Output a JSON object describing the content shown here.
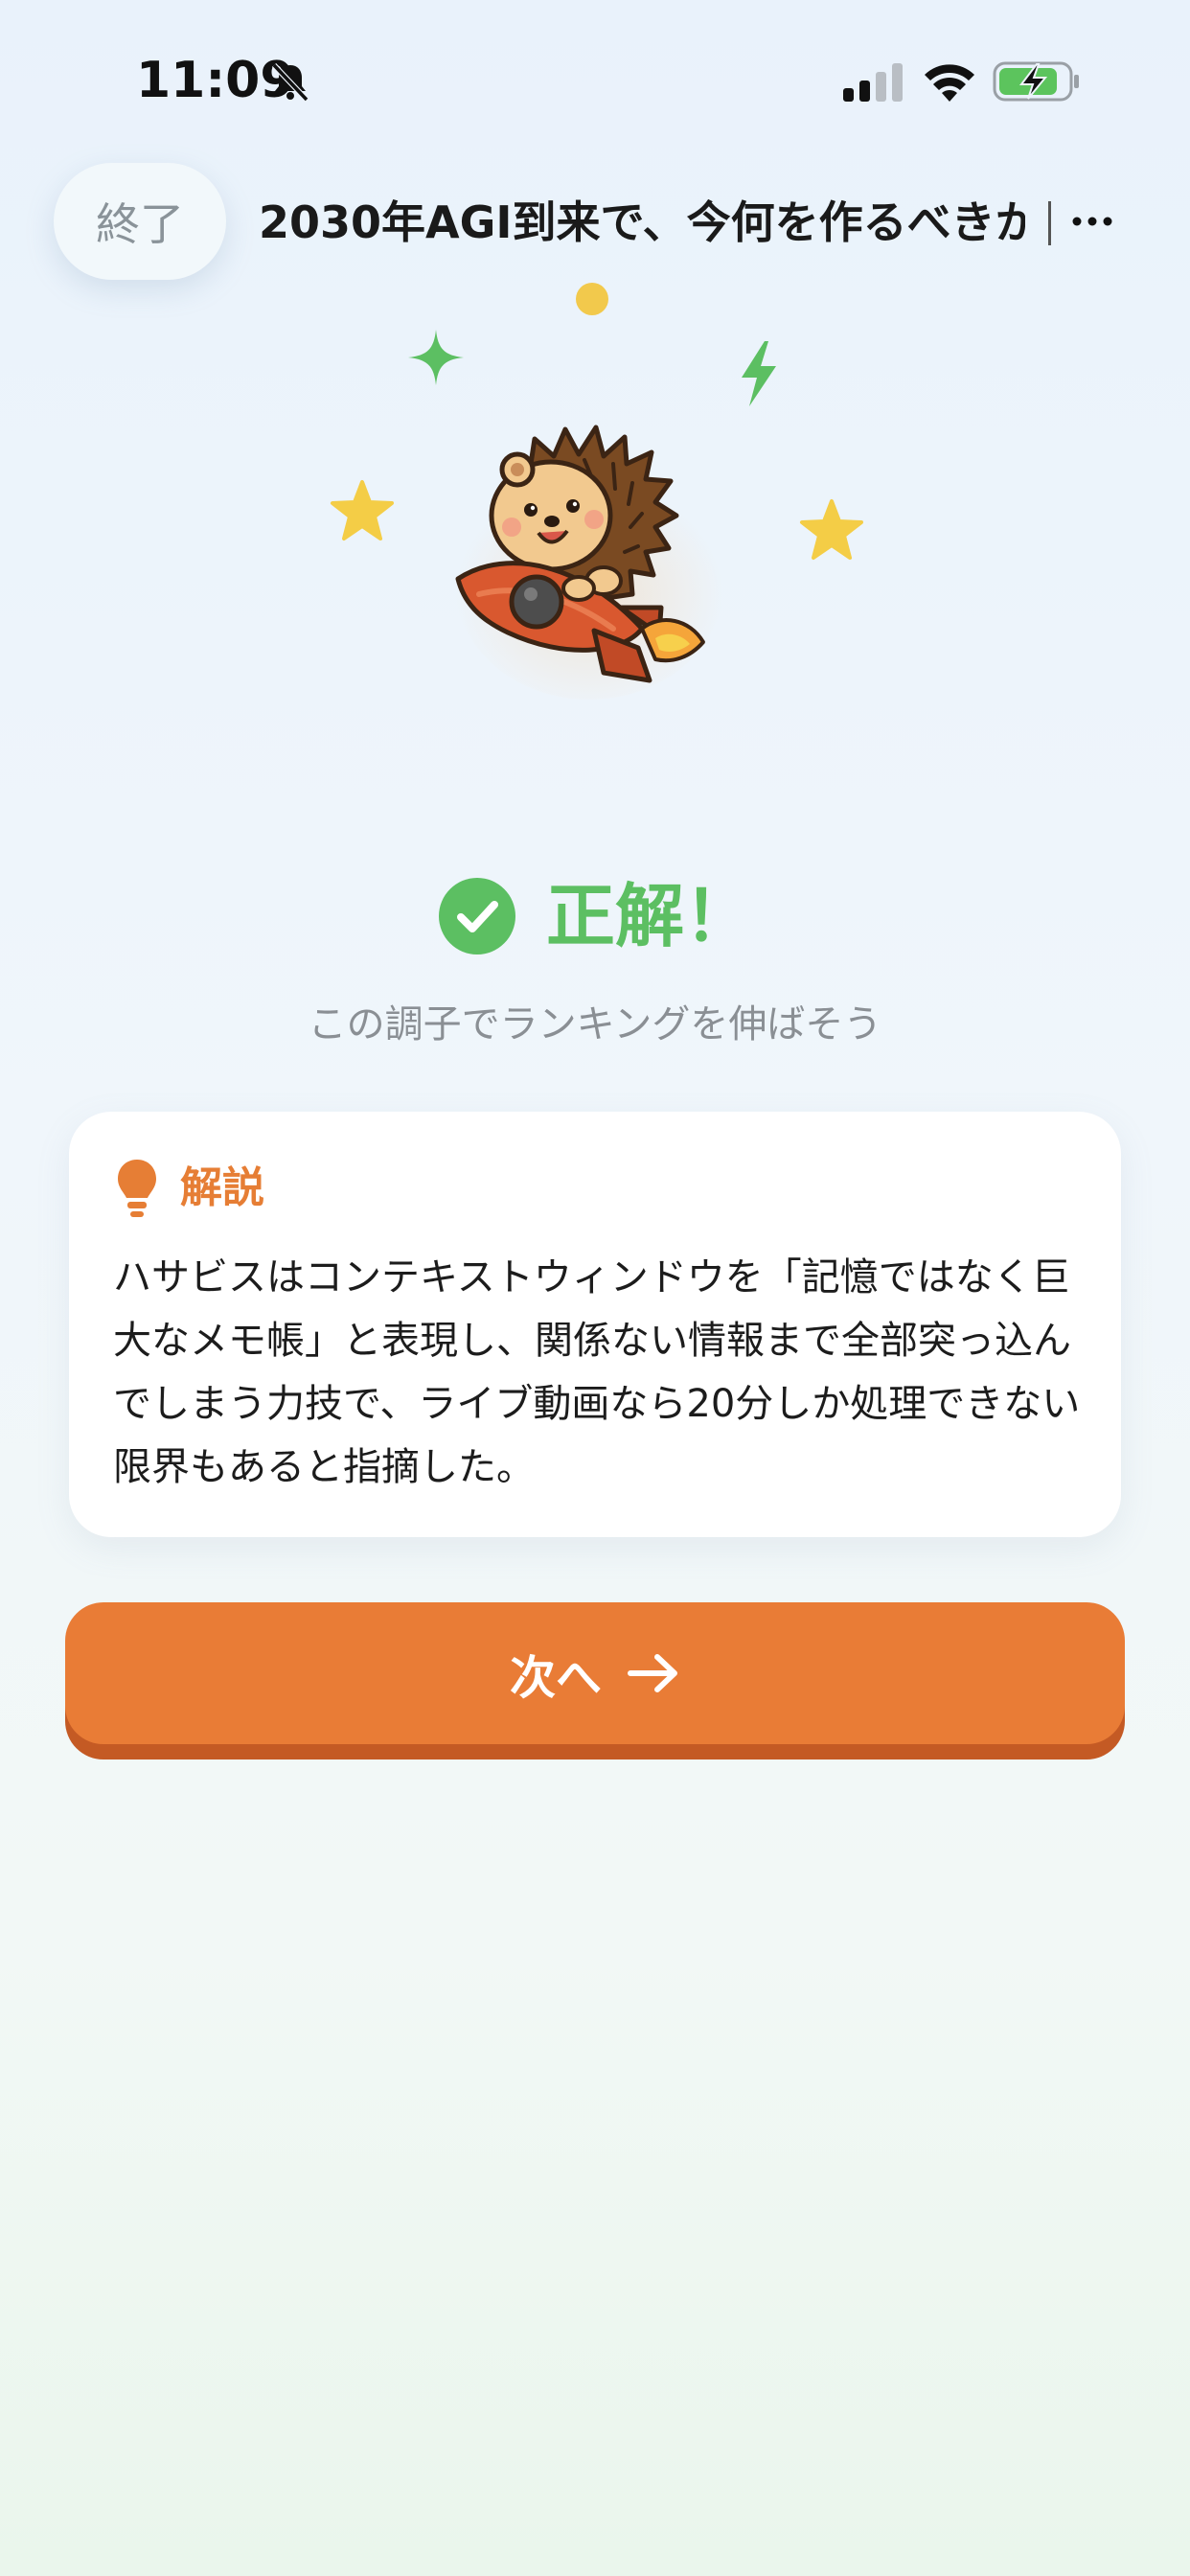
{
  "status_bar": {
    "time": "11:09",
    "icons": [
      "bell-muted-icon",
      "signal-icon",
      "wifi-icon",
      "battery-charging-icon"
    ],
    "battery_level": 0.75
  },
  "header": {
    "end_label": "終了",
    "title": "2030年AGI到来で、今何を作るべきか",
    "more_icon": "ellipsis-icon"
  },
  "illustration": {
    "subject": "hedgehog-on-rocket-icon",
    "decorations": [
      "dot-icon",
      "sparkle-icon",
      "lightning-icon",
      "star-icon",
      "star-icon"
    ]
  },
  "result": {
    "icon": "check-circle-icon",
    "title": "正解！",
    "subtitle": "この調子でランキングを伸ばそう"
  },
  "explanation": {
    "icon": "lightbulb-icon",
    "heading": "解説",
    "body": "ハサビスはコンテキストウィンドウを「記憶ではなく巨大なメモ帳」と表現し、関係ない情報まで全部突っ込んでしまう力技で、ライブ動画なら20分しか処理できない限界もあると指摘した。"
  },
  "next_button": {
    "label": "次へ",
    "icon": "arrow-right-icon"
  },
  "colors": {
    "accent": "#e97c36",
    "accent_dark": "#c45a24",
    "success": "#5cbf62",
    "heading_orange": "#e67e35"
  }
}
